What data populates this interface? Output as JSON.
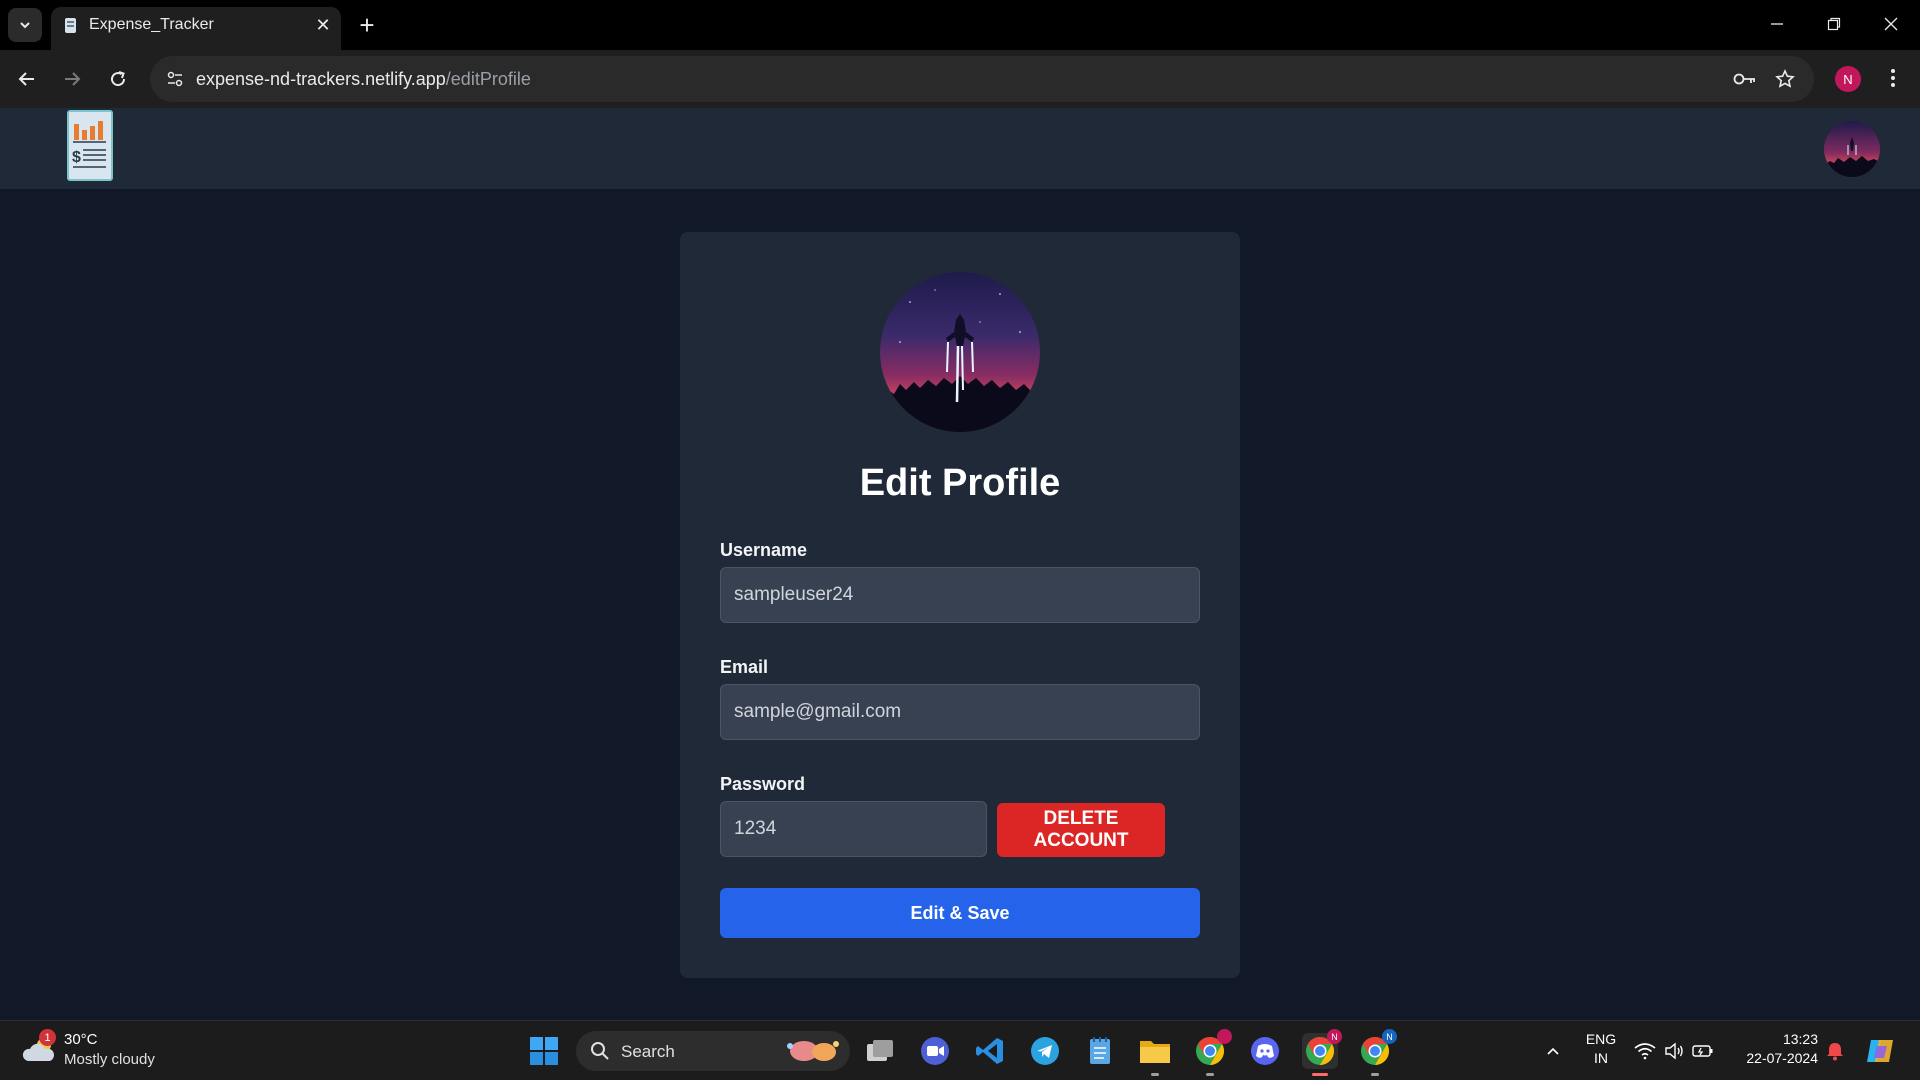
{
  "browser": {
    "tab_title": "Expense_Tracker",
    "url_host": "expense-nd-trackers.netlify.app",
    "url_path": "/editProfile",
    "profile_initial": "N"
  },
  "page": {
    "title": "Edit Profile",
    "username": {
      "label": "Username",
      "value": "sampleuser24"
    },
    "email": {
      "label": "Email",
      "value": "sample@gmail.com"
    },
    "password": {
      "label": "Password",
      "value": "1234"
    },
    "delete_button": "DELETE ACCOUNT",
    "save_button": "Edit & Save"
  },
  "colors": {
    "page_bg": "#111827",
    "card_bg": "#1f2937",
    "input_bg": "#374151",
    "danger": "#dc2626",
    "primary": "#2563eb"
  },
  "taskbar": {
    "weather_badge": "1",
    "weather_temp": "30°C",
    "weather_desc": "Mostly cloudy",
    "search_label": "Search",
    "lang_top": "ENG",
    "lang_bottom": "IN",
    "time": "13:23",
    "date": "22-07-2024",
    "app_badge_1": "N",
    "app_badge_2": "N",
    "icons": [
      "windows-start-icon",
      "search-icon",
      "task-view-icon",
      "zoom-icon",
      "vscode-icon",
      "telegram-icon",
      "notepad-icon",
      "file-explorer-icon",
      "chrome-icon",
      "discord-icon",
      "chrome-icon",
      "chrome-icon",
      "chevron-up-icon",
      "wifi-icon",
      "volume-icon",
      "battery-icon",
      "bell-icon",
      "copilot-icon"
    ]
  }
}
